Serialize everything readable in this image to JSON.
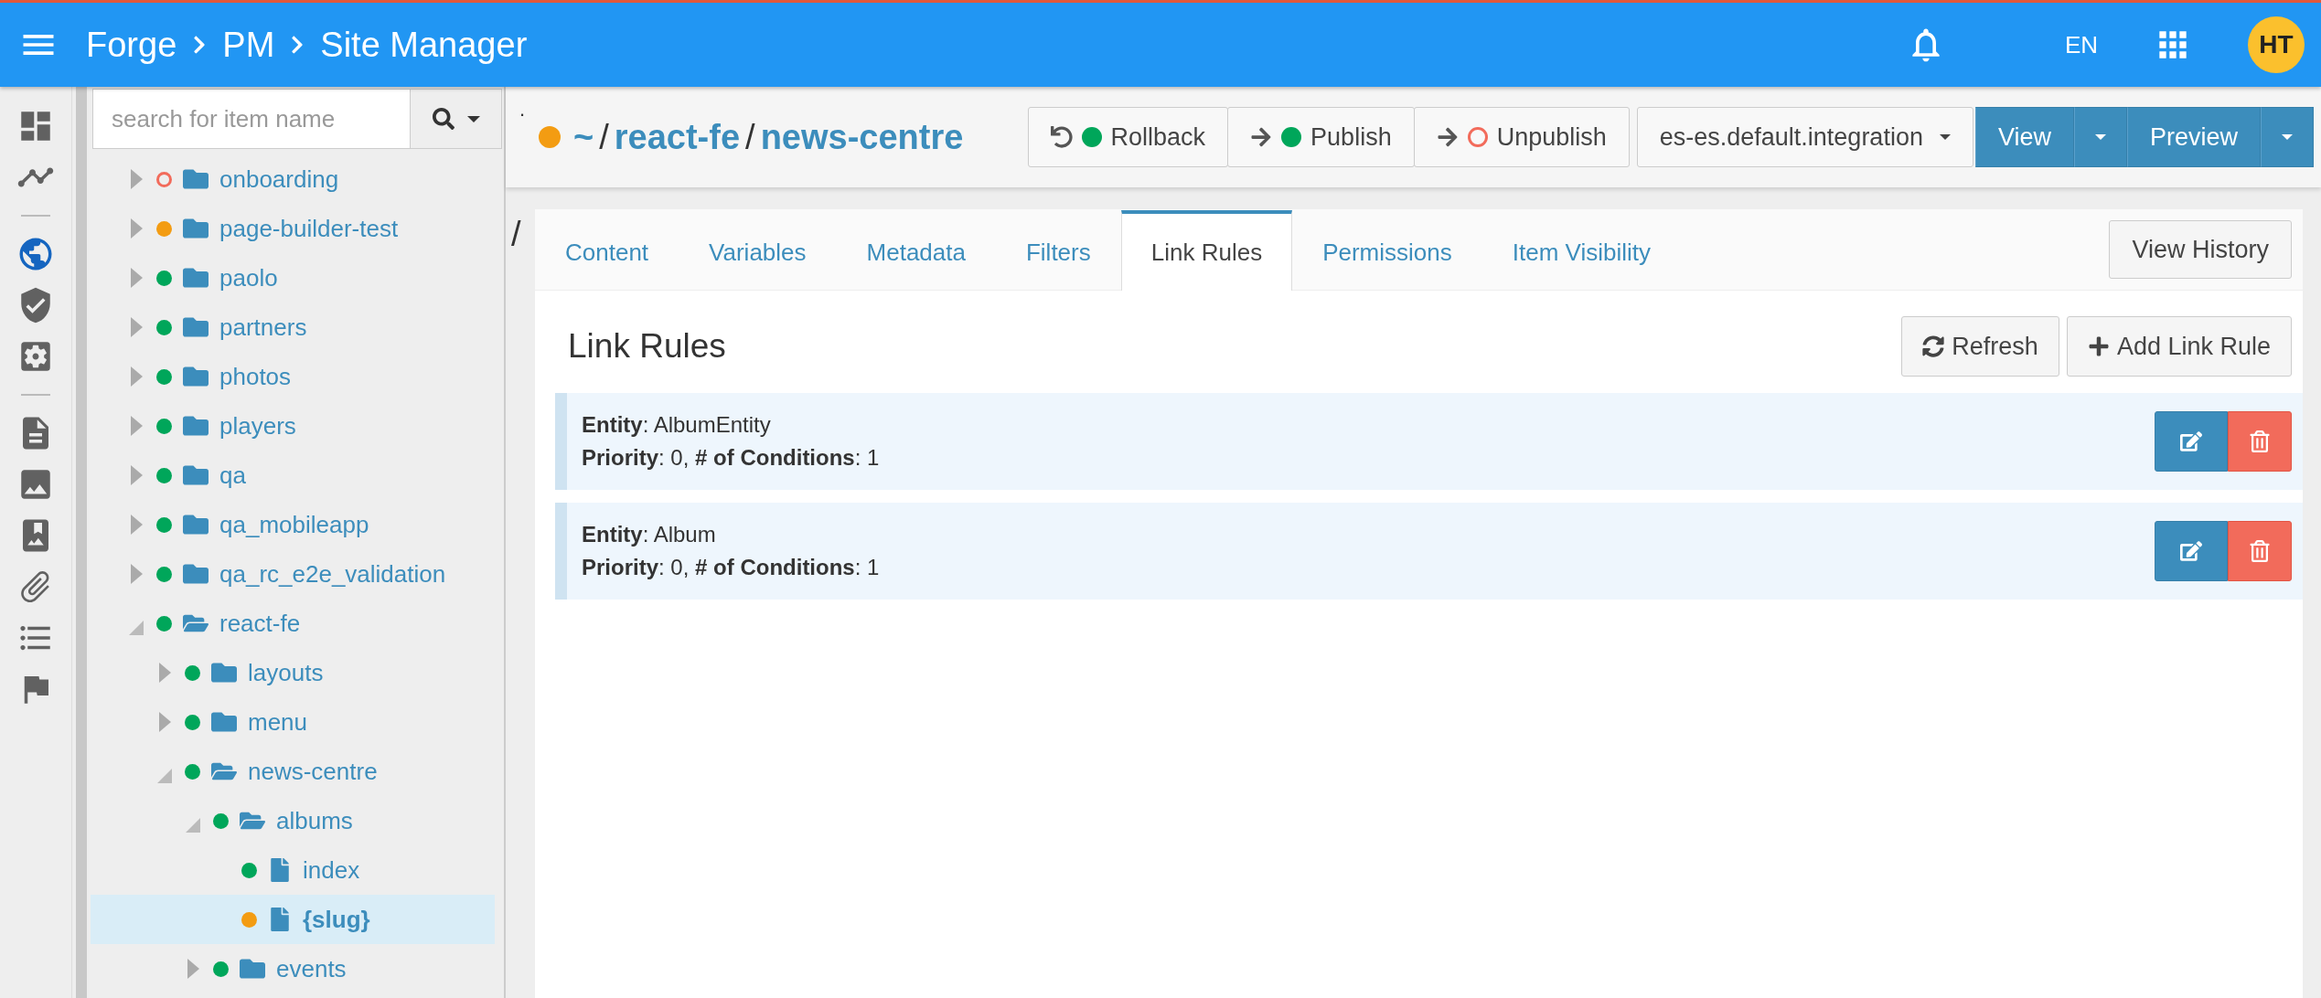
{
  "header": {
    "breadcrumb": [
      "Forge",
      "PM",
      "Site Manager"
    ],
    "language": "EN",
    "avatar": "HT"
  },
  "rail": [
    {
      "selected": false
    },
    {
      "selected": false
    },
    {
      "selected": true
    },
    {
      "selected": false
    },
    {
      "selected": false
    },
    {
      "selected": false
    },
    {
      "selected": false
    },
    {
      "selected": false
    },
    {
      "selected": false
    },
    {
      "selected": false
    },
    {
      "selected": false
    }
  ],
  "search": {
    "placeholder": "search for item name"
  },
  "tree": [
    {
      "label": "onboarding",
      "kind": "folder",
      "expanded": false,
      "selected": false,
      "color": "#f26b5b",
      "hollow": true
    },
    {
      "label": "page-builder-test",
      "kind": "folder",
      "expanded": false,
      "selected": false,
      "color": "#f39c12",
      "hollow": false
    },
    {
      "label": "paolo",
      "kind": "folder",
      "expanded": false,
      "selected": false,
      "color": "#00a65a",
      "hollow": false
    },
    {
      "label": "partners",
      "kind": "folder",
      "expanded": false,
      "selected": false,
      "color": "#00a65a",
      "hollow": false
    },
    {
      "label": "photos",
      "kind": "folder",
      "expanded": false,
      "selected": false,
      "color": "#00a65a",
      "hollow": false
    },
    {
      "label": "players",
      "kind": "folder",
      "expanded": false,
      "selected": false,
      "color": "#00a65a",
      "hollow": false
    },
    {
      "label": "qa",
      "kind": "folder",
      "expanded": false,
      "selected": false,
      "color": "#00a65a",
      "hollow": false
    },
    {
      "label": "qa_mobileapp",
      "kind": "folder",
      "expanded": false,
      "selected": false,
      "color": "#00a65a",
      "hollow": false
    },
    {
      "label": "qa_rc_e2e_validation",
      "kind": "folder",
      "expanded": false,
      "selected": false,
      "color": "#00a65a",
      "hollow": false
    },
    {
      "label": "react-fe",
      "kind": "folder",
      "expanded": true,
      "selected": false,
      "color": "#00a65a",
      "hollow": false,
      "children": [
        {
          "label": "layouts",
          "kind": "folder",
          "expanded": false,
          "selected": false,
          "color": "#00a65a",
          "hollow": false
        },
        {
          "label": "menu",
          "kind": "folder",
          "expanded": false,
          "selected": false,
          "color": "#00a65a",
          "hollow": false
        },
        {
          "label": "news-centre",
          "kind": "folder",
          "expanded": true,
          "selected": false,
          "color": "#00a65a",
          "hollow": false,
          "children": [
            {
              "label": "albums",
              "kind": "folder",
              "expanded": true,
              "selected": false,
              "color": "#00a65a",
              "hollow": false,
              "children": [
                {
                  "label": "index",
                  "kind": "page",
                  "selected": false,
                  "color": "#00a65a",
                  "hollow": false
                },
                {
                  "label": "{slug}",
                  "kind": "page",
                  "selected": true,
                  "color": "#f39c12",
                  "hollow": false
                }
              ]
            },
            {
              "label": "events",
              "kind": "folder",
              "expanded": false,
              "selected": false,
              "color": "#00a65a",
              "hollow": false
            }
          ]
        }
      ]
    }
  ],
  "toolbar": {
    "marker": ".",
    "status": {
      "color": "#f39c12"
    },
    "path": [
      {
        "text": "~",
        "kind": "link"
      },
      {
        "text": "/",
        "kind": "sep"
      },
      {
        "text": "react-fe",
        "kind": "link"
      },
      {
        "text": "/",
        "kind": "sep"
      },
      {
        "text": "news-centre",
        "kind": "link"
      }
    ],
    "actions": [
      {
        "label": "Rollback",
        "kind": "rollback",
        "color": "#00a65a",
        "hollow": false
      },
      {
        "label": "Publish",
        "kind": "publish",
        "color": "#00a65a",
        "hollow": false
      },
      {
        "label": "Unpublish",
        "kind": "publish",
        "color": "#f26b5b",
        "hollow": true
      }
    ],
    "environment": "es-es.default.integration",
    "view": "View",
    "preview": "Preview"
  },
  "content": {
    "prefix": "/",
    "tabs": [
      {
        "label": "Content",
        "selected": false
      },
      {
        "label": "Variables",
        "selected": false
      },
      {
        "label": "Metadata",
        "selected": false
      },
      {
        "label": "Filters",
        "selected": false
      },
      {
        "label": "Link Rules",
        "selected": true
      },
      {
        "label": "Permissions",
        "selected": false
      },
      {
        "label": "Item Visibility",
        "selected": false
      }
    ],
    "history_button": "View History",
    "title": "Link Rules",
    "refresh": "Refresh",
    "add": "Add Link Rule",
    "rules": [
      {
        "entity": "**Entity**: AlbumEntity",
        "details": "**Priority**: 0, **# of Conditions**: 1"
      },
      {
        "entity": "**Entity**: Album",
        "details": "**Priority**: 0, **# of Conditions**: 1"
      }
    ]
  }
}
